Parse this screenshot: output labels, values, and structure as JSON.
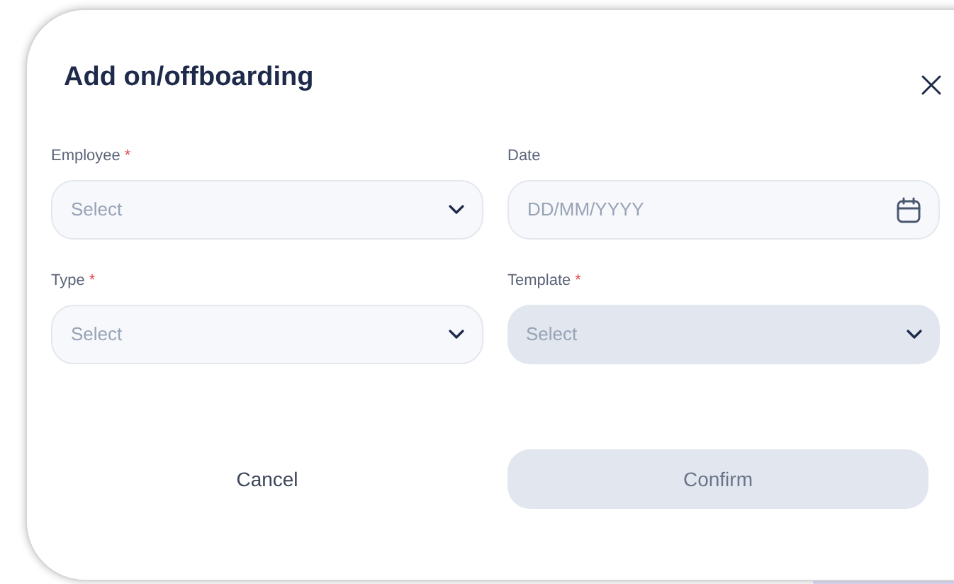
{
  "dialog": {
    "title": "Add on/offboarding"
  },
  "fields": [
    {
      "label": "Employee",
      "required": true,
      "kind": "select",
      "placeholder": "Select",
      "disabled": false
    },
    {
      "label": "Date",
      "required": false,
      "kind": "date",
      "placeholder": "DD/MM/YYYY",
      "disabled": false
    },
    {
      "label": "Type",
      "required": true,
      "kind": "select",
      "placeholder": "Select",
      "disabled": false
    },
    {
      "label": "Template",
      "required": true,
      "kind": "select",
      "placeholder": "Select",
      "disabled": true
    }
  ],
  "required_mark": "*",
  "buttons": [
    {
      "label": "Cancel",
      "kind": "text",
      "disabled": false
    },
    {
      "label": "Confirm",
      "kind": "primary",
      "disabled": true
    }
  ]
}
